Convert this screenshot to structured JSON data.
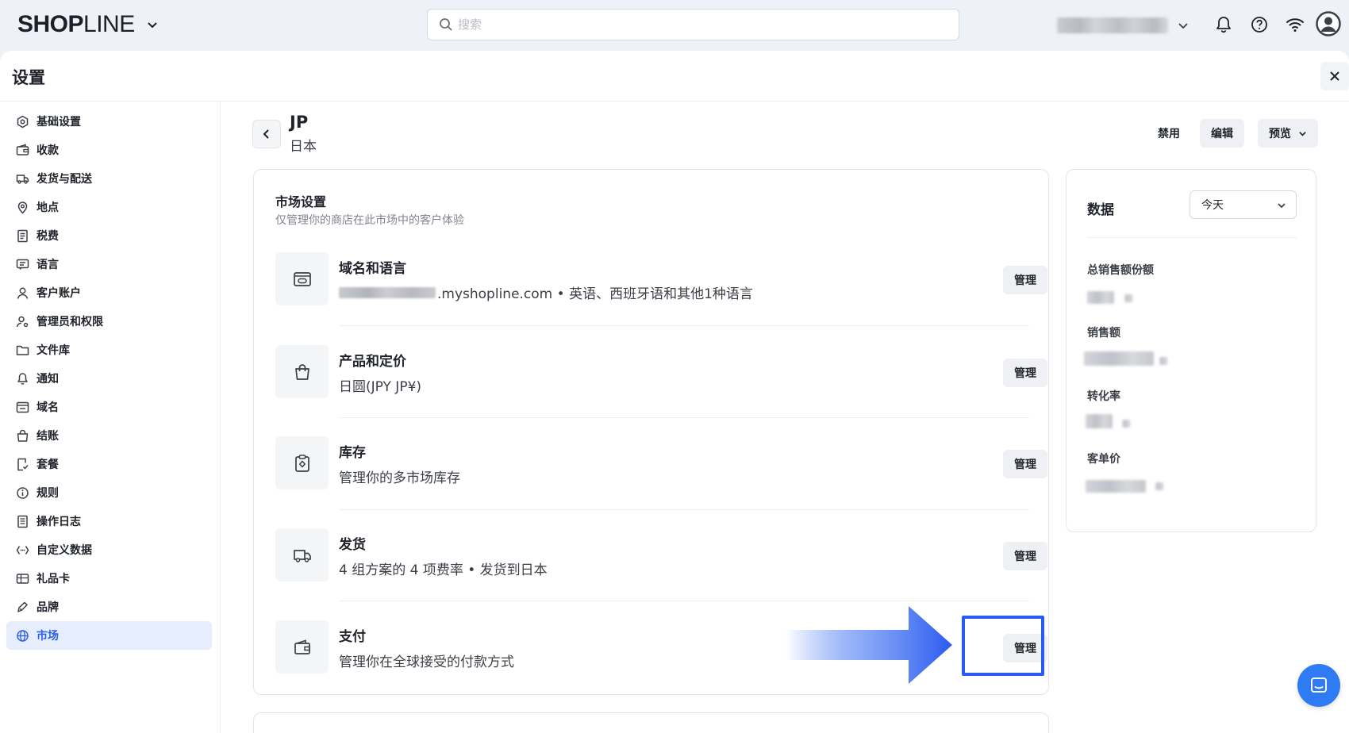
{
  "topbar": {
    "logo_bold": "SHOP",
    "logo_light": "LINE",
    "search_placeholder": "搜索"
  },
  "settings": {
    "title": "设置"
  },
  "sidebar": {
    "items": [
      {
        "label": "基础设置",
        "icon": "gear-icon"
      },
      {
        "label": "收款",
        "icon": "wallet-icon"
      },
      {
        "label": "发货与配送",
        "icon": "truck-icon"
      },
      {
        "label": "地点",
        "icon": "location-icon"
      },
      {
        "label": "税费",
        "icon": "receipt-icon"
      },
      {
        "label": "语言",
        "icon": "translate-icon"
      },
      {
        "label": "客户账户",
        "icon": "user-icon"
      },
      {
        "label": "管理员和权限",
        "icon": "admin-icon"
      },
      {
        "label": "文件库",
        "icon": "folder-icon"
      },
      {
        "label": "通知",
        "icon": "bell-icon"
      },
      {
        "label": "域名",
        "icon": "domain-icon"
      },
      {
        "label": "结账",
        "icon": "bag-icon"
      },
      {
        "label": "套餐",
        "icon": "plan-icon"
      },
      {
        "label": "规则",
        "icon": "info-icon"
      },
      {
        "label": "操作日志",
        "icon": "log-icon"
      },
      {
        "label": "自定义数据",
        "icon": "code-icon"
      },
      {
        "label": "礼品卡",
        "icon": "giftcard-icon"
      },
      {
        "label": "品牌",
        "icon": "brand-icon"
      },
      {
        "label": "市场",
        "icon": "globe-icon",
        "active": true
      }
    ]
  },
  "market": {
    "code": "JP",
    "name": "日本",
    "disable_label": "禁用",
    "edit_label": "编辑",
    "preview_label": "预览"
  },
  "market_settings": {
    "title": "市场设置",
    "subtitle": "仅管理你的商店在此市场中的客户体验",
    "rows": [
      {
        "title": "域名和语言",
        "desc": ".myshopline.com • 英语、西班牙语和其他1种语言",
        "button": "管理",
        "icon": "domain-icon"
      },
      {
        "title": "产品和定价",
        "desc": "日圆(JPY JP¥)",
        "button": "管理",
        "icon": "shopping-bag-icon"
      },
      {
        "title": "库存",
        "desc": "管理你的多市场库存",
        "button": "管理",
        "icon": "inventory-icon"
      },
      {
        "title": "发货",
        "desc": "4 组方案的 4 项费率 • 发货到日本",
        "button": "管理",
        "icon": "truck-icon"
      },
      {
        "title": "支付",
        "desc": "管理你在全球接受的付款方式",
        "button": "管理",
        "icon": "wallet-icon"
      }
    ]
  },
  "data_panel": {
    "title": "数据",
    "period": "今天",
    "metrics": [
      {
        "label": "总销售额份额"
      },
      {
        "label": "销售额"
      },
      {
        "label": "转化率"
      },
      {
        "label": "客单价"
      }
    ]
  },
  "colors": {
    "accent": "#2e5fe6",
    "highlight": "#2a5bf0",
    "chat": "#2f7bf4"
  }
}
